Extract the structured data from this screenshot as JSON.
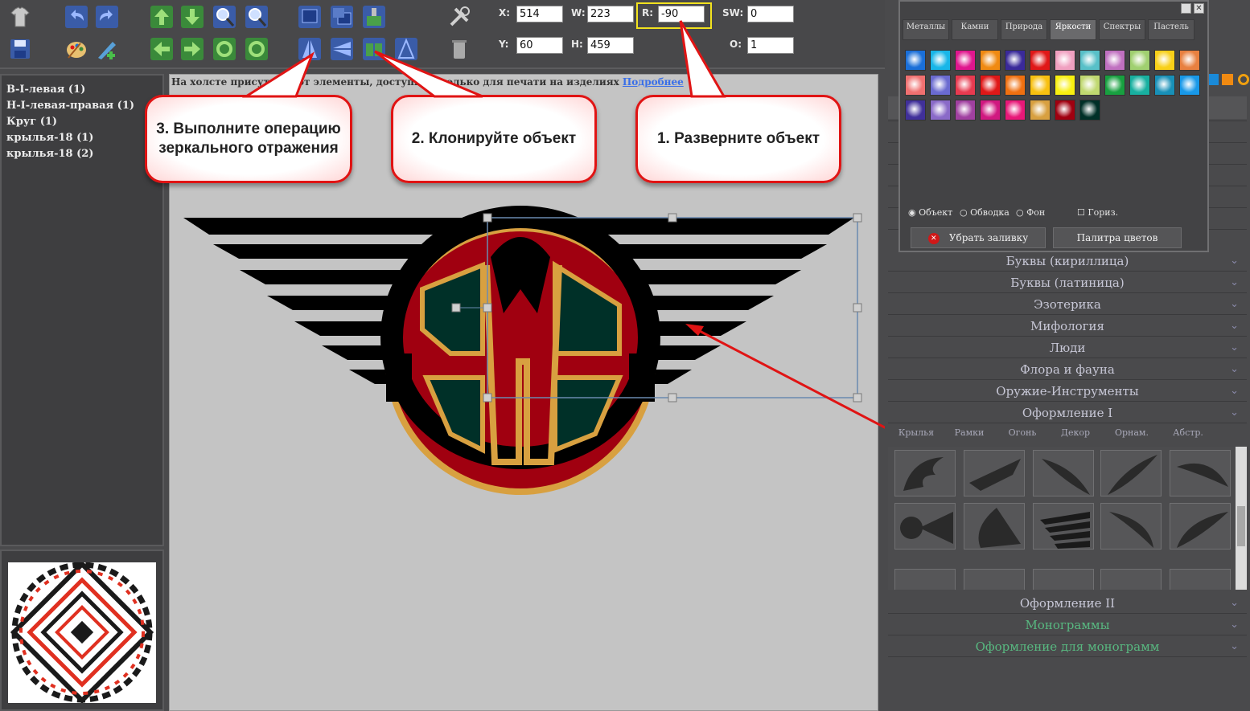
{
  "toolbar": {
    "fields": {
      "x_label": "X:",
      "x_value": "514",
      "y_label": "Y:",
      "y_value": "60",
      "w_label": "W:",
      "w_value": "223",
      "h_label": "H:",
      "h_value": "459",
      "r_label": "R:",
      "r_value": "-90",
      "sw_label": "SW:",
      "sw_value": "0",
      "o_label": "O:",
      "o_value": "1"
    }
  },
  "layers": [
    "В-I-левая (1)",
    "Н-I-левая-правая (1)",
    "Круг (1)",
    "крылья-18 (1)",
    "крылья-18 (2)"
  ],
  "canvas": {
    "notice_text": "На холсте присутствуют элементы, доступные только для печати на изделиях ",
    "notice_link": "Подробнее"
  },
  "callouts": {
    "step1": "1. Разверните объект",
    "step2": "2. Клонируйте объект",
    "step3": "3. Выполните операцию зеркального отражения"
  },
  "color_window": {
    "tabs": [
      "Металлы",
      "Камни",
      "Природа",
      "Яркости",
      "Спектры",
      "Пастель"
    ],
    "active_tab": "Яркости",
    "swatches": [
      "#1a6fd8",
      "#18b6e8",
      "#e0168e",
      "#f08a12",
      "#3a2a9a",
      "#e01818",
      "#f0a0c0",
      "#58c0c8",
      "#c070c0",
      "#a0d070",
      "#f8d018",
      "#e88040",
      "#f07070",
      "#6a6ad0",
      "#e83a50",
      "#e01818",
      "#f07010",
      "#f8c010",
      "#f8f010",
      "#c0d870",
      "#18a040",
      "#18b0a0",
      "#1890b8",
      "#1898e8",
      "#40309a",
      "#8a6ac8",
      "#a040a0",
      "#d01880",
      "#e81878",
      "#d8a040",
      "#a00010",
      "#003028"
    ],
    "radio_object": "Объект",
    "radio_stroke": "Обводка",
    "radio_bg": "Фон",
    "checkbox_horiz": "Гориз.",
    "btn_remove_fill": "Убрать заливку",
    "btn_palette": "Палитра цветов"
  },
  "categories_top": [
    "Буквы (кириллица)",
    "Буквы (латиница)",
    "Эзотерика",
    "Мифология",
    "Люди",
    "Флора и фауна",
    "Оружие-Инструменты",
    "Оформление I"
  ],
  "sub_tabs": [
    "Крылья",
    "Рамки",
    "Огонь",
    "Декор",
    "Орнам.",
    "Абстр."
  ],
  "categories_bottom": [
    "Оформление II",
    "Монограммы",
    "Оформление для монограмм"
  ]
}
